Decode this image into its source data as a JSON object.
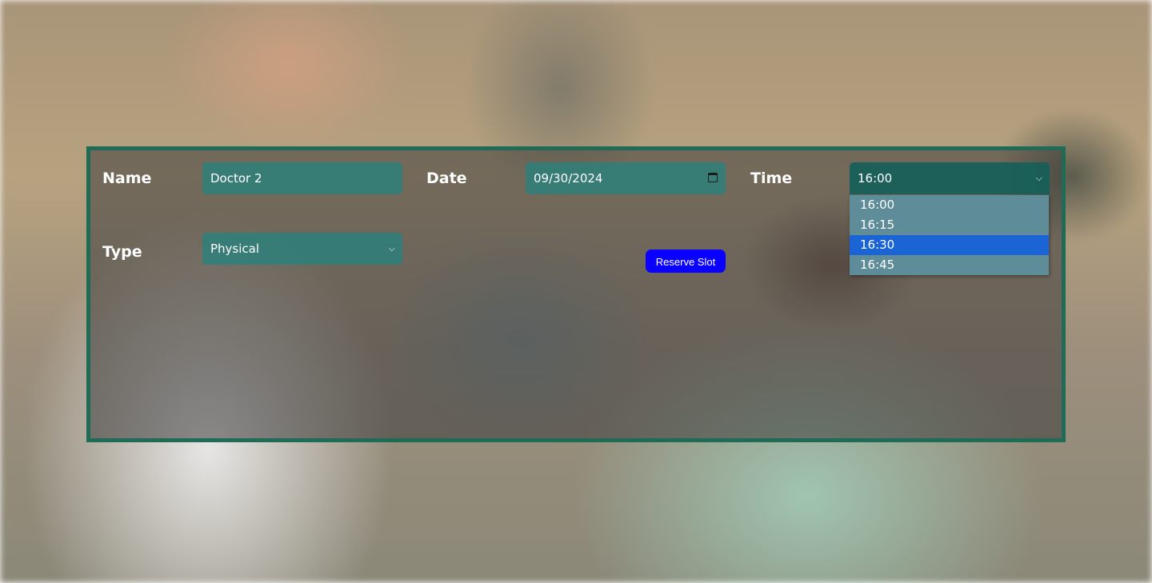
{
  "form": {
    "name_label": "Name",
    "name_value": "Doctor 2",
    "date_label": "Date",
    "date_value": "09/30/2024",
    "time_label": "Time",
    "time_value": "16:00",
    "type_label": "Type",
    "type_value": "Physical",
    "reserve_button": "Reserve Slot"
  },
  "time_dropdown": {
    "options": [
      "16:00",
      "16:15",
      "16:30",
      "16:45"
    ],
    "highlighted": "16:30"
  },
  "icons": {
    "date_picker": "calendar-icon",
    "select_arrow": "chevron-down-icon"
  },
  "colors": {
    "panel_border": "#1f6b55",
    "field_bg": "#28827d",
    "button_bg": "#0a00ff",
    "option_highlight": "#1a64d6"
  }
}
